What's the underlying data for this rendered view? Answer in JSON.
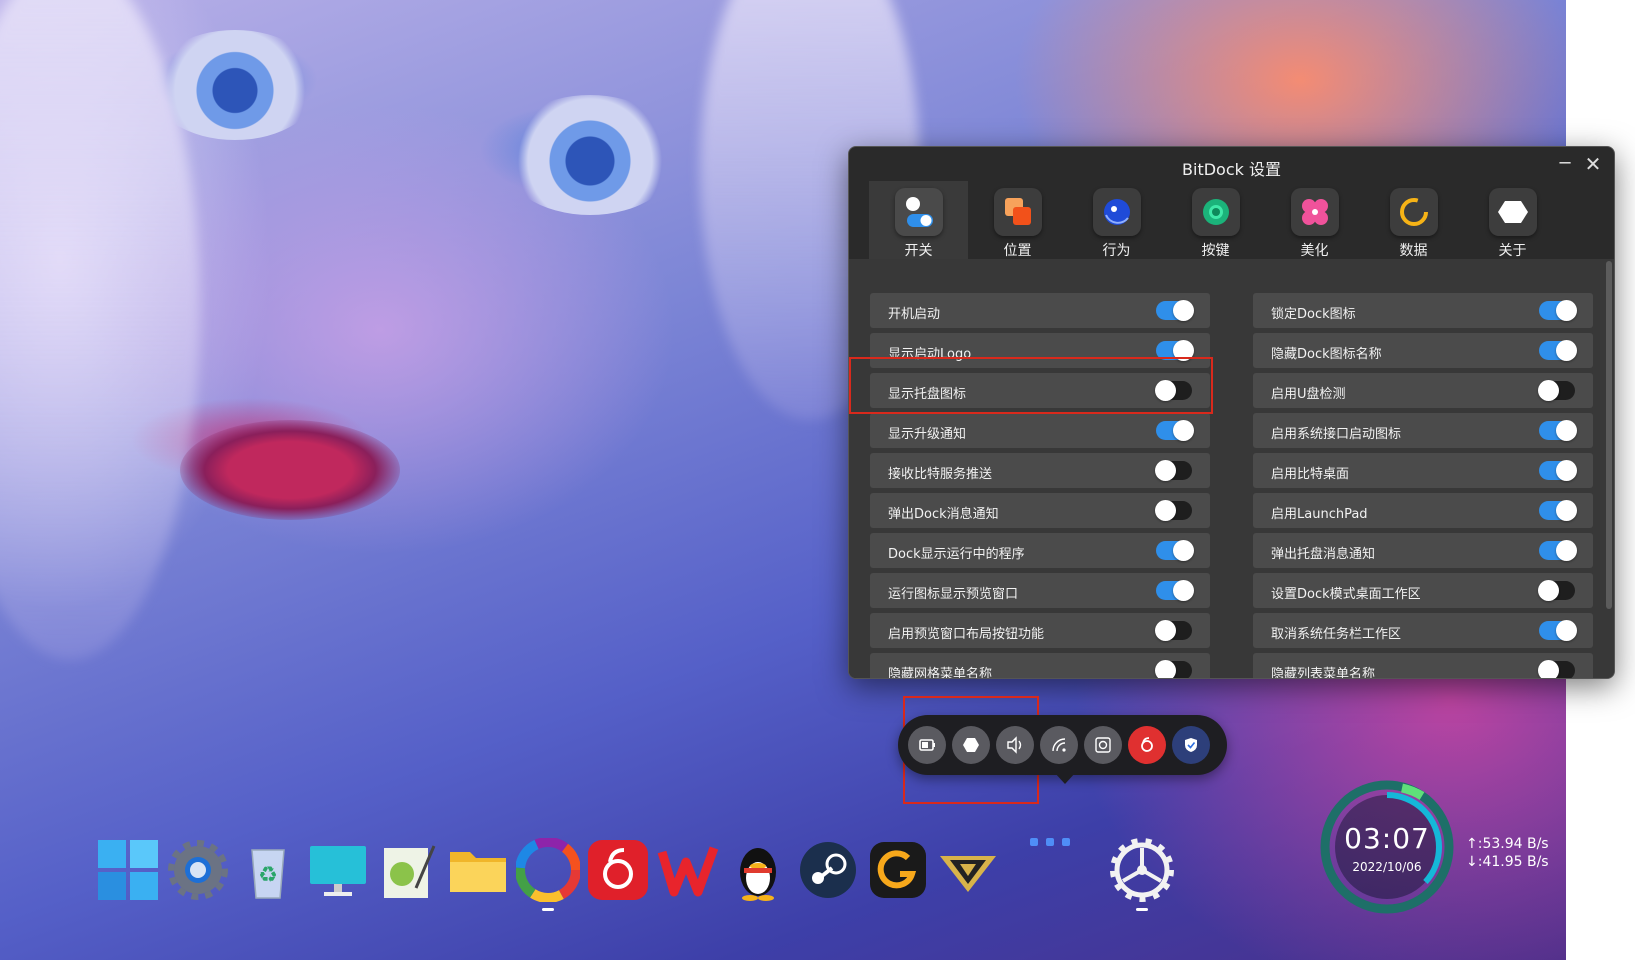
{
  "window": {
    "title": "BitDock 设置",
    "minimize_glyph": "─",
    "close_glyph": "✕"
  },
  "tabs": [
    {
      "label": "开关",
      "icon": "toggle-switch-icon",
      "active": true
    },
    {
      "label": "位置",
      "icon": "position-squares-icon",
      "active": false
    },
    {
      "label": "行为",
      "icon": "behavior-dot-icon",
      "active": false
    },
    {
      "label": "按键",
      "icon": "key-circle-icon",
      "active": false
    },
    {
      "label": "美化",
      "icon": "flower-icon",
      "active": false
    },
    {
      "label": "数据",
      "icon": "data-ring-icon",
      "active": false
    },
    {
      "label": "关于",
      "icon": "hexagon-icon",
      "active": false
    }
  ],
  "settings_left": [
    {
      "label": "开机启动",
      "on": true
    },
    {
      "label": "显示启动Logo",
      "on": true
    },
    {
      "label": "显示托盘图标",
      "on": false
    },
    {
      "label": "显示升级通知",
      "on": true
    },
    {
      "label": "接收比特服务推送",
      "on": false
    },
    {
      "label": "弹出Dock消息通知",
      "on": false
    },
    {
      "label": "Dock显示运行中的程序",
      "on": true
    },
    {
      "label": "运行图标显示预览窗口",
      "on": true
    },
    {
      "label": "启用预览窗口布局按钮功能",
      "on": false
    },
    {
      "label": "隐藏网格菜单名称",
      "on": false
    }
  ],
  "settings_right": [
    {
      "label": "锁定Dock图标",
      "on": true
    },
    {
      "label": "隐藏Dock图标名称",
      "on": true
    },
    {
      "label": "启用U盘检测",
      "on": false
    },
    {
      "label": "启用系统接口启动图标",
      "on": true
    },
    {
      "label": "启用比特桌面",
      "on": true
    },
    {
      "label": "启用LaunchPad",
      "on": true
    },
    {
      "label": "弹出托盘消息通知",
      "on": true
    },
    {
      "label": "设置Dock模式桌面工作区",
      "on": false
    },
    {
      "label": "取消系统任务栏工作区",
      "on": true
    },
    {
      "label": "隐藏列表菜单名称",
      "on": false
    }
  ],
  "tray_icons": [
    "battery-icon",
    "bitdock-hexagon-icon",
    "speaker-icon",
    "wifi-icon",
    "screenshot-icon",
    "netease-music-icon",
    "shield-icon"
  ],
  "dock_icons": [
    {
      "name": "windows-start-icon",
      "running": false
    },
    {
      "name": "settings-gear-icon",
      "running": false
    },
    {
      "name": "recycle-bin-icon",
      "running": false
    },
    {
      "name": "monitor-icon",
      "running": false
    },
    {
      "name": "notepad-plus-icon",
      "running": false
    },
    {
      "name": "folder-icon",
      "running": false
    },
    {
      "name": "color-wheel-browser-icon",
      "running": true
    },
    {
      "name": "netease-music-dock-icon",
      "running": false
    },
    {
      "name": "wps-office-icon",
      "running": false
    },
    {
      "name": "qq-penguin-icon",
      "running": false
    },
    {
      "name": "steam-icon",
      "running": false
    },
    {
      "name": "gg-app-icon",
      "running": false
    },
    {
      "name": "game-emblem-icon",
      "running": false
    },
    {
      "name": "more-dots-icon",
      "running": false
    },
    {
      "name": "bitdock-settings-icon",
      "running": true
    }
  ],
  "clock": {
    "time": "03:07",
    "date": "2022/10/06"
  },
  "network": {
    "up": "↑:53.94 B/s",
    "down": "↓:41.95 B/s"
  },
  "colors": {
    "accent": "#2f8fea",
    "highlight": "#d9291c",
    "panel": "#2a2a2a"
  }
}
